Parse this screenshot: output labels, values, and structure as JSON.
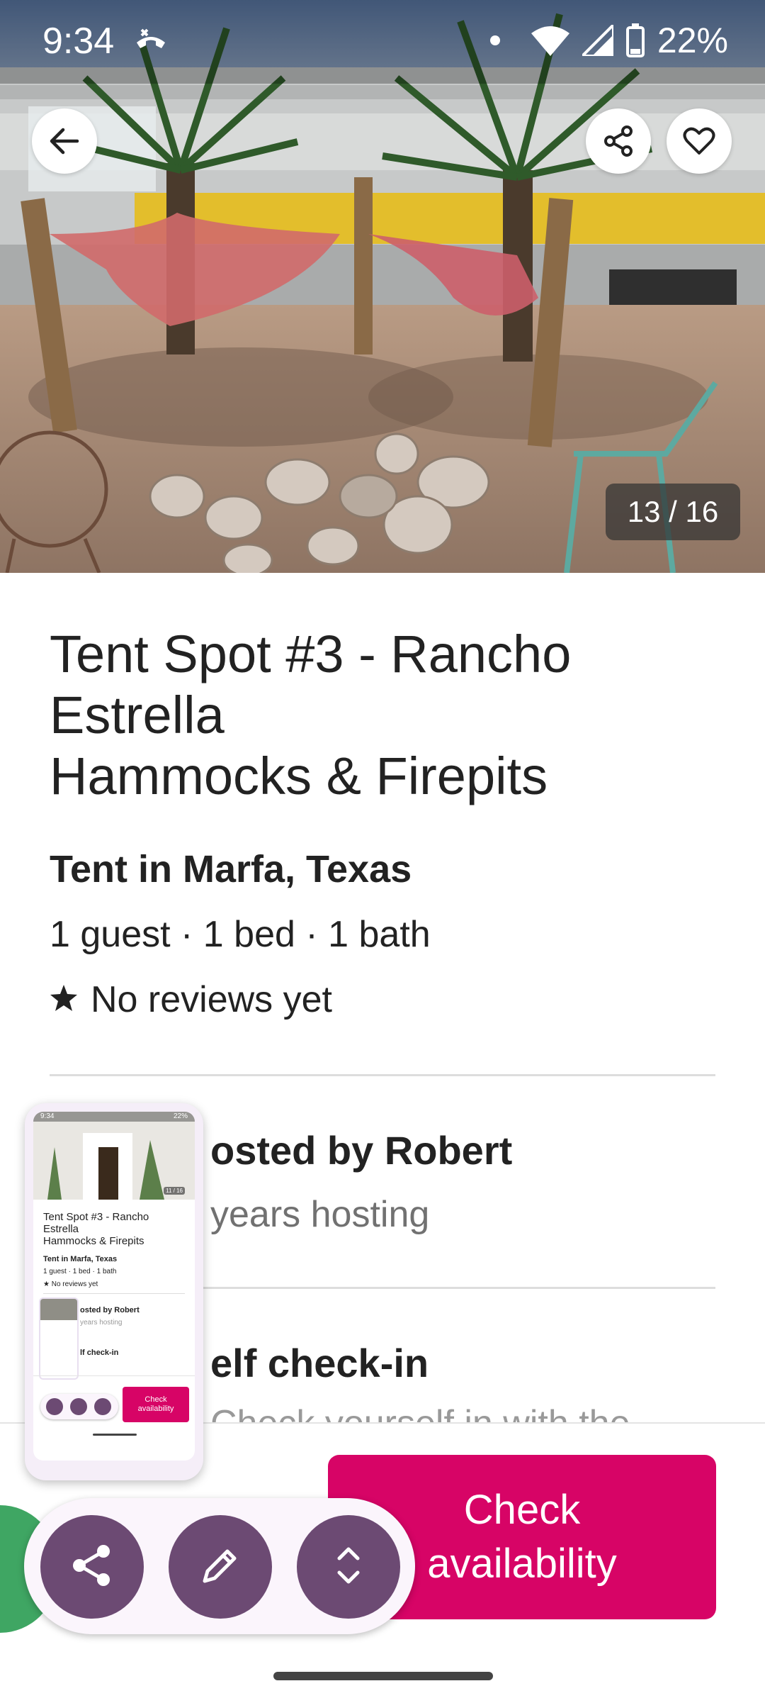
{
  "status_bar": {
    "time": "9:34",
    "battery": "22%"
  },
  "photo": {
    "counter": "13 / 16"
  },
  "listing": {
    "title_lines": [
      "Tent Spot #3 - Rancho",
      "Estrella",
      "Hammocks & Firepits"
    ],
    "subtitle": "Tent in Marfa, Texas",
    "facts": "1 guest · 1 bed · 1 bath",
    "reviews": "No reviews yet"
  },
  "host": {
    "title": "osted by Robert",
    "subtitle": "years hosting"
  },
  "checkin": {
    "title": "elf check-in",
    "description": "Check yourself in with the"
  },
  "booking": {
    "button_label": "Check availability"
  },
  "thumbnail": {
    "time": "9:34",
    "battery": "22%",
    "counter": "11 / 16",
    "title_lines": [
      "Tent Spot #3 - Rancho",
      "Estrella",
      "Hammocks & Firepits"
    ],
    "subtitle": "Tent in Marfa, Texas",
    "facts": "1 guest · 1 bed · 1 bath",
    "reviews": "No reviews yet",
    "host_title": "osted by Robert",
    "host_sub": "years hosting",
    "checkin_title": "lf check-in",
    "button_label": "Check availability"
  },
  "icons": {
    "back": "arrow-left-icon",
    "share": "share-icon",
    "save": "heart-icon",
    "star": "star-icon",
    "edit": "pencil-icon",
    "expand": "expand-vertical-icon"
  },
  "colors": {
    "brand": "#d70466",
    "fab": "#6c4a73",
    "accent_green": "#3fa663"
  }
}
